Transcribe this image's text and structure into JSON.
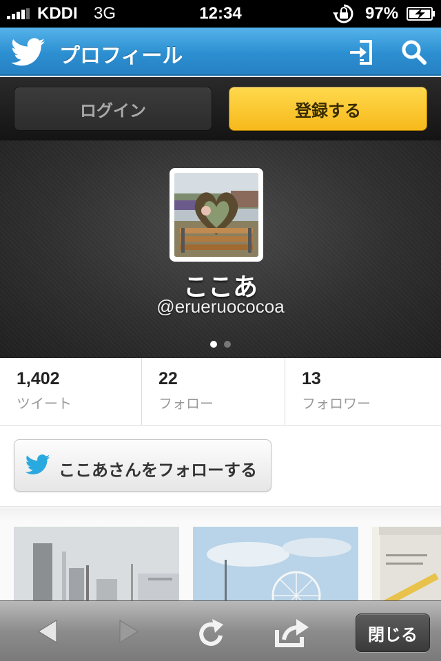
{
  "status_bar": {
    "carrier": "KDDI",
    "network": "3G",
    "time": "12:34",
    "battery": "97%"
  },
  "nav": {
    "title": "プロフィール",
    "icons": [
      "twitter-bird-icon",
      "sign-in-icon",
      "search-icon"
    ]
  },
  "auth": {
    "login_label": "ログイン",
    "register_label": "登録する"
  },
  "profile": {
    "display_name": "ここあ",
    "handle": "@erueruococoa",
    "page_dots_total": 2,
    "page_dots_active": 1
  },
  "stats": [
    {
      "value": "1,402",
      "label": "ツイート"
    },
    {
      "value": "22",
      "label": "フォロー"
    },
    {
      "value": "13",
      "label": "フォロワー"
    }
  ],
  "follow": {
    "label": "ここあさんをフォローする"
  },
  "toolbar": {
    "close_label": "閉じる",
    "icons": [
      "back-arrow-icon",
      "forward-arrow-icon",
      "reload-icon",
      "share-icon"
    ]
  },
  "colors": {
    "nav_blue": "#2c8fd1",
    "register_yellow": "#f7b91c",
    "twitter_blue": "#2aa9e0"
  }
}
